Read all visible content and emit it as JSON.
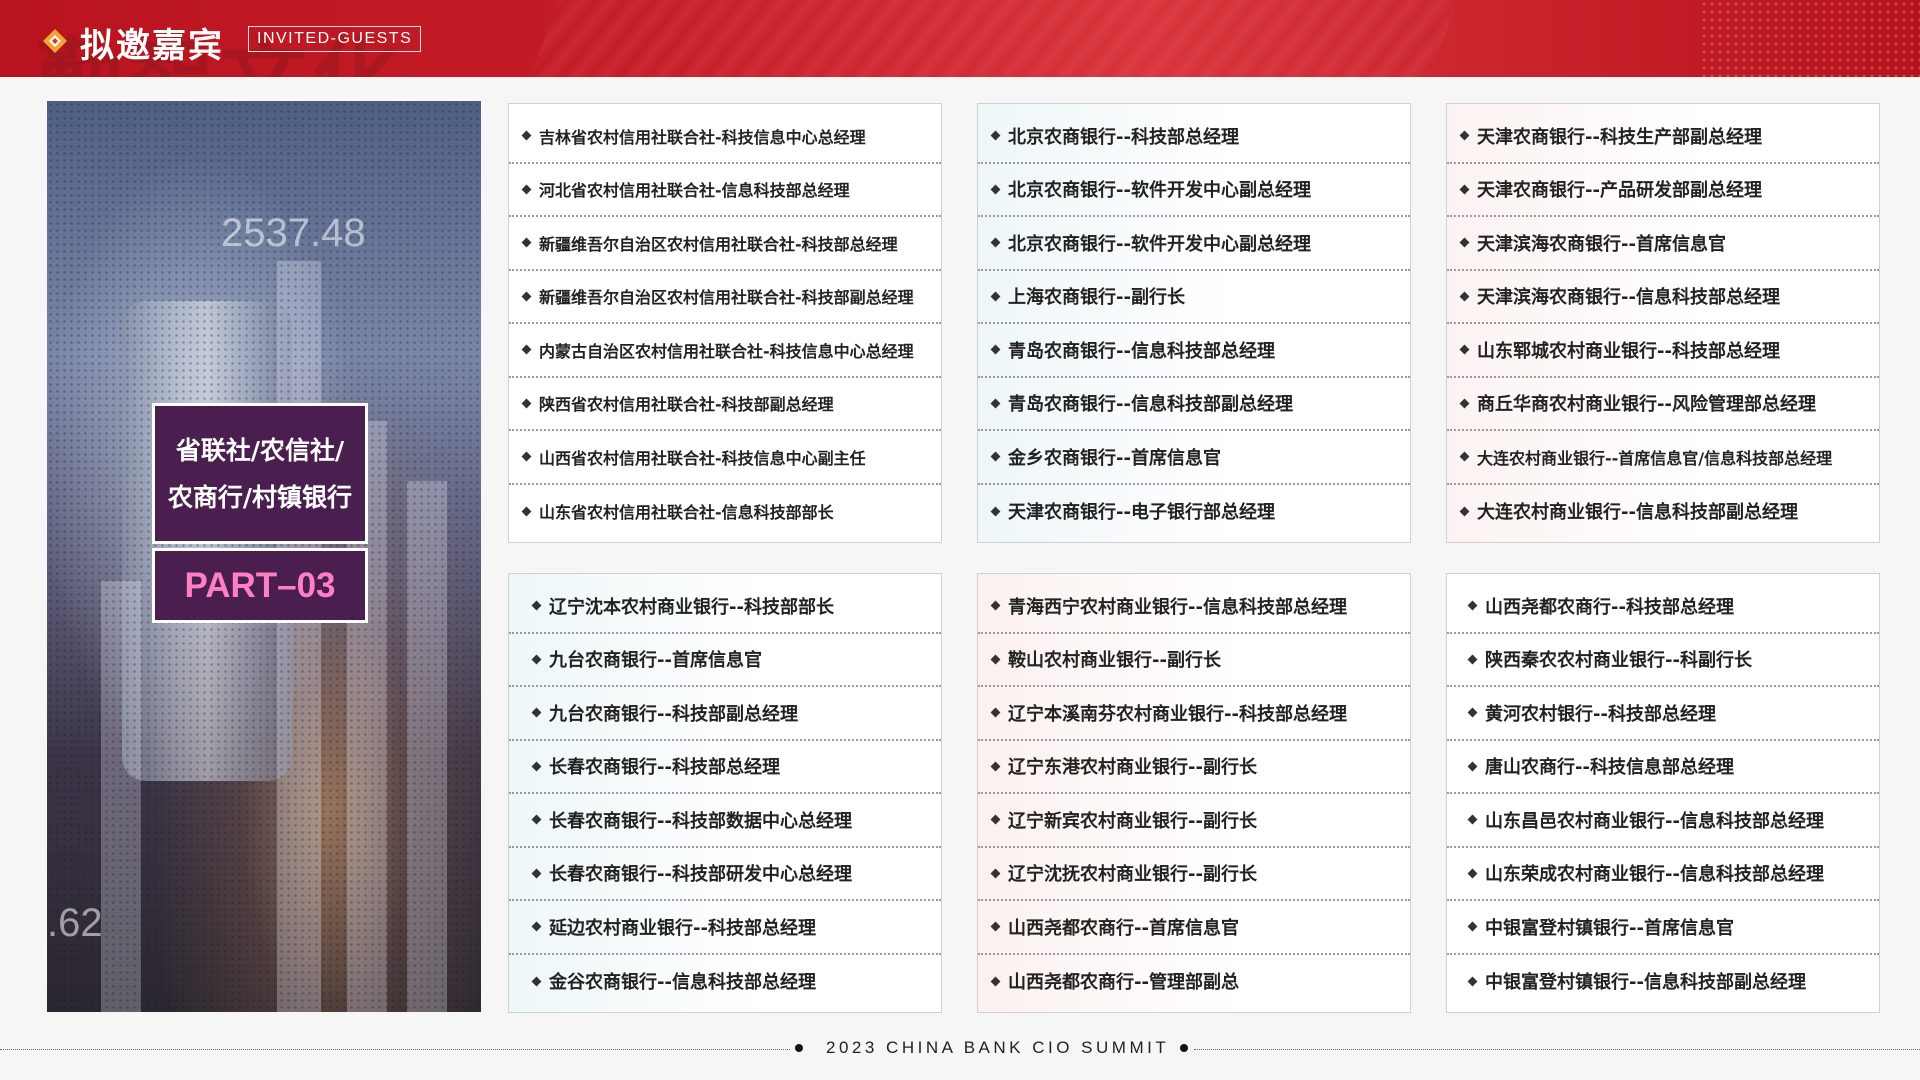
{
  "header": {
    "title": "拟邀嘉宾",
    "subtitle": "INVITED-GUESTS",
    "ghost_text": "勤智文化"
  },
  "left_panel": {
    "tag_line1": "省联社/农信社/",
    "tag_line2": "农商行/村镇银行",
    "part_label": "PART–03",
    "photo_number_1": "2537.48",
    "photo_number_2": ".62"
  },
  "cards": [
    {
      "items": [
        "吉林省农村信用社联合社-科技信息中心总经理",
        "河北省农村信用社联合社-信息科技部总经理",
        "新疆维吾尔自治区农村信用社联合社-科技部总经理",
        "新疆维吾尔自治区农村信用社联合社-科技部副总经理",
        "内蒙古自治区农村信用社联合社-科技信息中心总经理",
        "陕西省农村信用社联合社-科技部副总经理",
        "山西省农村信用社联合社-科技信息中心副主任",
        "山东省农村信用社联合社-信息科技部部长"
      ]
    },
    {
      "items": [
        "北京农商银行--科技部总经理",
        "北京农商银行--软件开发中心副总经理",
        "北京农商银行--软件开发中心副总经理",
        "上海农商银行--副行长",
        "青岛农商银行--信息科技部总经理",
        "青岛农商银行--信息科技部副总经理",
        "金乡农商银行--首席信息官",
        "天津农商银行--电子银行部总经理"
      ]
    },
    {
      "items": [
        "天津农商银行--科技生产部副总经理",
        "天津农商银行--产品研发部副总经理",
        "天津滨海农商银行--首席信息官",
        "天津滨海农商银行--信息科技部总经理",
        "山东郓城农村商业银行--科技部总经理",
        "商丘华商农村商业银行--风险管理部总经理",
        "大连农村商业银行--首席信息官/信息科技部总经理",
        "大连农村商业银行--信息科技部副总经理"
      ]
    },
    {
      "items": [
        "辽宁沈本农村商业银行--科技部部长",
        "九台农商银行--首席信息官",
        "九台农商银行--科技部副总经理",
        "长春农商银行--科技部总经理",
        "长春农商银行--科技部数据中心总经理",
        "长春农商银行--科技部研发中心总经理",
        "延边农村商业银行--科技部总经理",
        "金谷农商银行--信息科技部总经理"
      ]
    },
    {
      "items": [
        "青海西宁农村商业银行--信息科技部总经理",
        "鞍山农村商业银行--副行长",
        "辽宁本溪南芬农村商业银行--科技部总经理",
        "辽宁东港农村商业银行--副行长",
        "辽宁新宾农村商业银行--副行长",
        "辽宁沈抚农村商业银行--副行长",
        "山西尧都农商行--首席信息官",
        "山西尧都农商行--管理部副总"
      ]
    },
    {
      "items": [
        "山西尧都农商行--科技部总经理",
        "陕西秦农农村商业银行--科副行长",
        "黄河农村银行--科技部总经理",
        "唐山农商行--科技信息部总经理",
        "山东昌邑农村商业银行--信息科技部总经理",
        "山东荣成农村商业银行--信息科技部总经理",
        "中银富登村镇银行--首席信息官",
        "中银富登村镇银行--信息科技部副总经理"
      ]
    }
  ],
  "footer": {
    "text": "2023 CHINA BANK CIO SUMMIT"
  }
}
